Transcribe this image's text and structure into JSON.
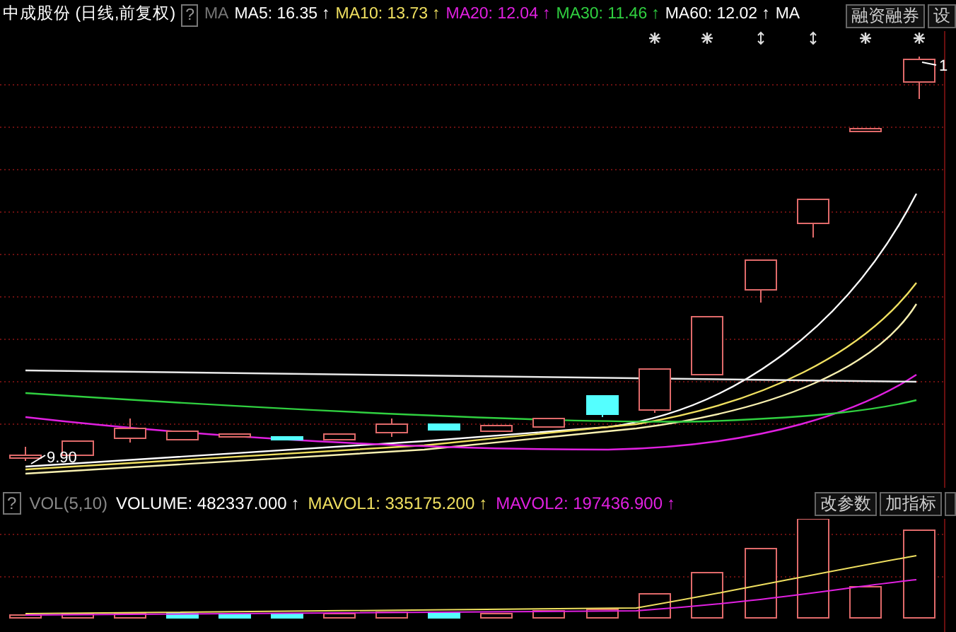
{
  "header": {
    "title": "中成股份 (日线,前复权)",
    "help": "?",
    "indicator": "MA",
    "values": [
      {
        "text": "MA5: 16.35",
        "arrow": "↑",
        "color": "#ffffff"
      },
      {
        "text": "MA10: 13.73",
        "arrow": "↑",
        "color": "#f0e060"
      },
      {
        "text": "MA20: 12.04",
        "arrow": "↑",
        "color": "#e020e0"
      },
      {
        "text": "MA30: 11.46",
        "arrow": "↑",
        "color": "#30d040"
      },
      {
        "text": "MA60: 12.02",
        "arrow": "↑",
        "color": "#ffffff"
      },
      {
        "text": "MA",
        "color": "#ffffff"
      }
    ],
    "buttons": [
      "融资融券",
      "设"
    ]
  },
  "price_chart": {
    "low_label": "9.90",
    "high_label": "1"
  },
  "volume_header": {
    "help": "?",
    "indicator": "VOL(5,10)",
    "values": [
      {
        "text": "VOLUME: 482337.000",
        "arrow": "↑",
        "color": "#ffffff"
      },
      {
        "text": "MAVOL1: 335175.200",
        "arrow": "↑",
        "color": "#f0e060"
      },
      {
        "text": "MAVOL2: 197436.900",
        "arrow": "↑",
        "color": "#e020e0"
      }
    ],
    "buttons": [
      "改参数",
      "加指标"
    ]
  }
}
